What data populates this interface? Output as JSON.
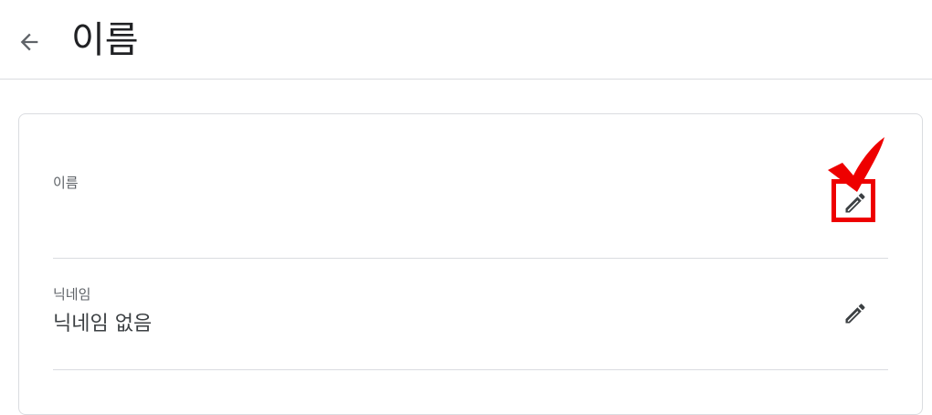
{
  "header": {
    "back_icon": "arrow-back-icon",
    "title": "이름"
  },
  "card": {
    "fields": [
      {
        "label": "이름",
        "value": "",
        "action_icon": "pencil-icon"
      },
      {
        "label": "닉네임",
        "value": "닉네임 없음",
        "action_icon": "pencil-icon"
      }
    ]
  },
  "annotation": {
    "color": "#ee0000",
    "icon": "checkmark-icon"
  }
}
